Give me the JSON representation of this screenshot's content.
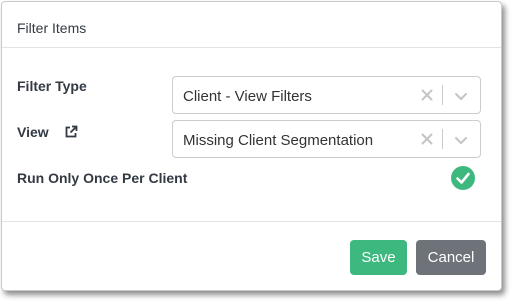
{
  "dialog": {
    "title": "Filter Items"
  },
  "form": {
    "filter_type": {
      "label": "Filter Type",
      "value": "Client - View Filters",
      "clear_icon": "close-icon",
      "dropdown_icon": "chevron-down-icon"
    },
    "view": {
      "label": "View",
      "link_icon": "external-link-icon",
      "value": "Missing Client Segmentation",
      "clear_icon": "close-icon",
      "dropdown_icon": "chevron-down-icon"
    },
    "run_once": {
      "label": "Run Only Once Per Client",
      "checked": true,
      "icon": "check-circle-icon"
    }
  },
  "footer": {
    "save_label": "Save",
    "cancel_label": "Cancel"
  },
  "colors": {
    "save": "#3db97f",
    "cancel": "#6e7279",
    "check": "#3db97f"
  }
}
